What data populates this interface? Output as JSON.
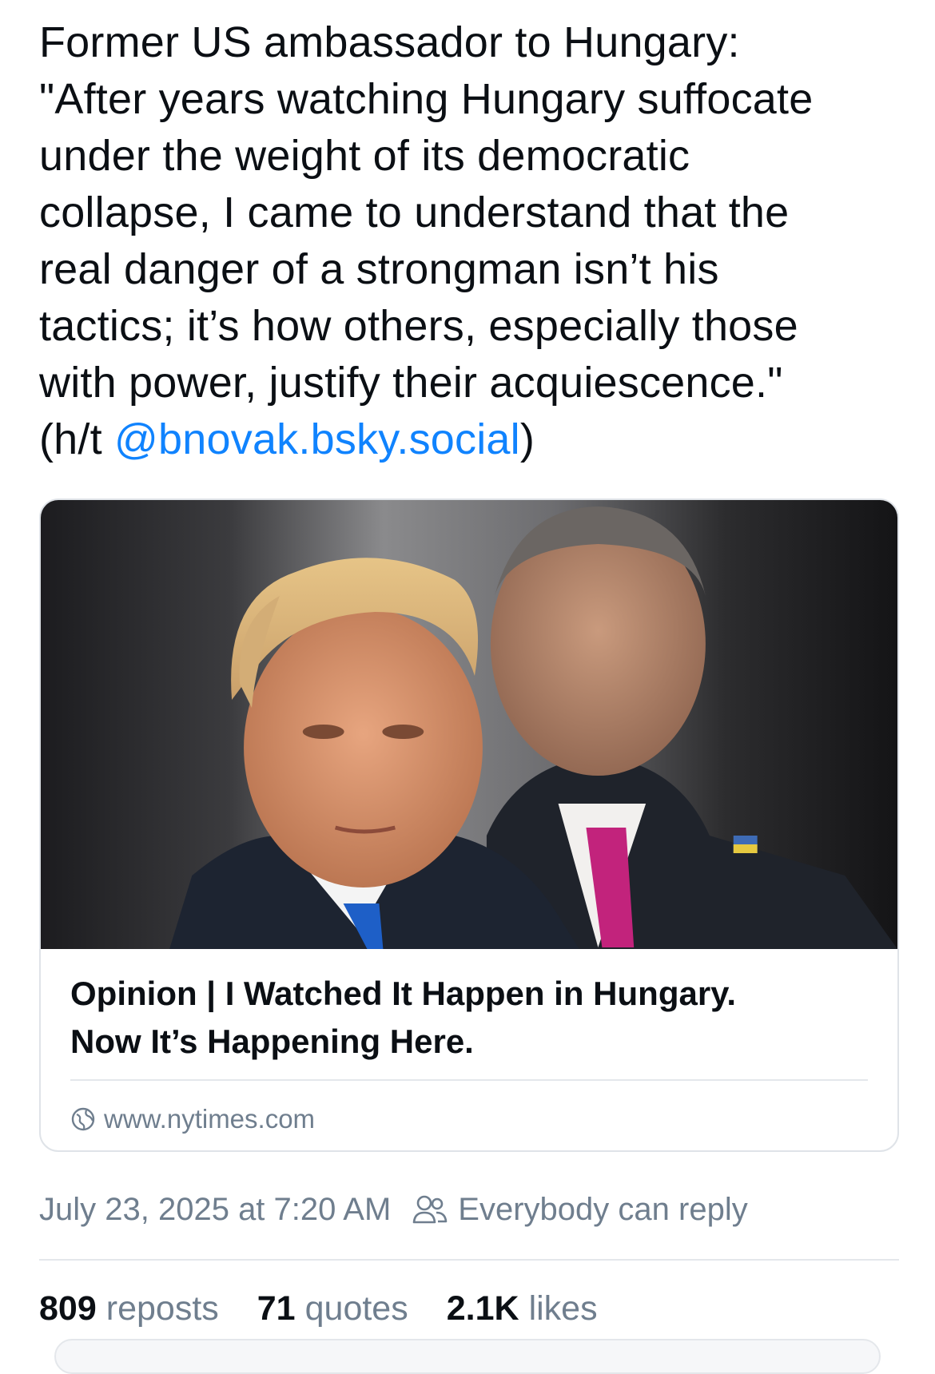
{
  "post": {
    "text_lines": [
      "Former US ambassador to Hungary:",
      "\"After years watching Hungary suffocate",
      "under the weight of its democratic",
      "collapse, I came to understand that the",
      "real danger of a strongman isn’t his",
      "tactics; it’s how others, especially those",
      "with power, justify their acquiescence.\""
    ],
    "ht_prefix": "(h/t ",
    "mention": "@bnovak.bsky.social",
    "ht_suffix": ")",
    "mention_color": "#1083fe"
  },
  "link_card": {
    "title_line1": "Opinion | I Watched It Happen in Hungary.",
    "title_line2": "Now It’s Happening Here.",
    "domain": "www.nytimes.com",
    "domain_icon": "globe-icon"
  },
  "meta": {
    "timestamp": "July 23, 2025 at 7:20 AM",
    "reply_setting": "Everybody can reply",
    "reply_icon": "people-icon"
  },
  "stats": {
    "reposts_count": "809",
    "reposts_label": "reposts",
    "quotes_count": "71",
    "quotes_label": "quotes",
    "likes_count": "2.1K",
    "likes_label": "likes"
  }
}
